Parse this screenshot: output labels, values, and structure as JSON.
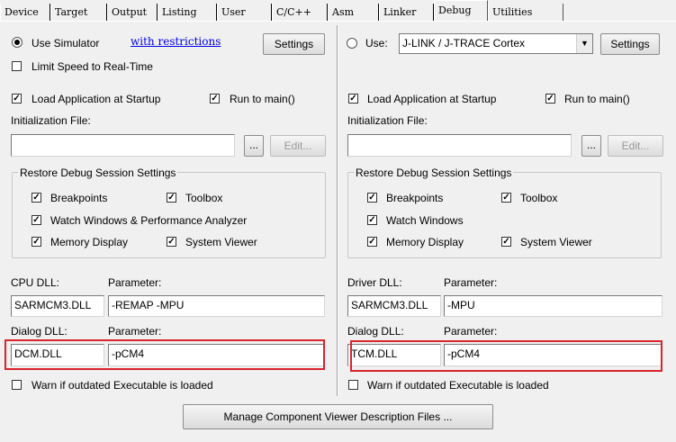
{
  "tabs": [
    "Device",
    "Target",
    "Output",
    "Listing",
    "User",
    "C/C++",
    "Asm",
    "Linker",
    "Debug",
    "Utilities"
  ],
  "left": {
    "use_simulator_label": "Use Simulator",
    "with_restrictions_link": "with restrictions",
    "settings_label": "Settings",
    "limit_speed_label": "Limit Speed to Real-Time",
    "load_app_label": "Load Application at Startup",
    "run_to_main_label": "Run to main()",
    "init_file_label": "Initialization File:",
    "init_file_value": "",
    "browse_label": "...",
    "edit_label": "Edit...",
    "restore_title": "Restore Debug Session Settings",
    "breakpoints_label": "Breakpoints",
    "toolbox_label": "Toolbox",
    "watch_label": "Watch Windows & Performance Analyzer",
    "memory_label": "Memory Display",
    "sysviewer_label": "System Viewer",
    "cpu_dll_label": "CPU DLL:",
    "cpu_param_label": "Parameter:",
    "cpu_dll_value": "SARMCM3.DLL",
    "cpu_param_value": "-REMAP -MPU",
    "dialog_dll_label": "Dialog DLL:",
    "dialog_param_label": "Parameter:",
    "dialog_dll_value": "DCM.DLL",
    "dialog_param_value": "-pCM4",
    "warn_label": "Warn if outdated Executable is loaded"
  },
  "right": {
    "use_label": "Use:",
    "debugger_value": "J-LINK / J-TRACE Cortex",
    "settings_label": "Settings",
    "load_app_label": "Load Application at Startup",
    "run_to_main_label": "Run to main()",
    "init_file_label": "Initialization File:",
    "init_file_value": "",
    "browse_label": "...",
    "edit_label": "Edit...",
    "restore_title": "Restore Debug Session Settings",
    "breakpoints_label": "Breakpoints",
    "toolbox_label": "Toolbox",
    "watch_label": "Watch Windows",
    "memory_label": "Memory Display",
    "sysviewer_label": "System Viewer",
    "driver_dll_label": "Driver DLL:",
    "driver_param_label": "Parameter:",
    "driver_dll_value": "SARMCM3.DLL",
    "driver_param_value": "-MPU",
    "dialog_dll_label": "Dialog DLL:",
    "dialog_param_label": "Parameter:",
    "dialog_dll_value": "TCM.DLL",
    "dialog_param_value": "-pCM4",
    "warn_label": "Warn if outdated Executable is loaded"
  },
  "manage_button_label": "Manage Component Viewer Description Files ...",
  "check_glyph": "✓",
  "dropdown_glyph": "▼",
  "highlight_color": "#d9232d"
}
